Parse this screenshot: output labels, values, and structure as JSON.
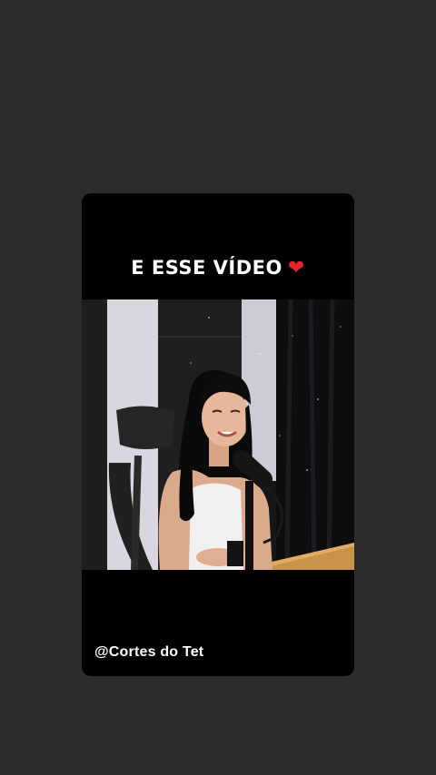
{
  "story": {
    "caption_text": "E ESSE VÍDEO",
    "caption_emoji": "❤",
    "watermark": "@Cortes do Tet"
  },
  "colors": {
    "page_background": "#2d2c2c",
    "card_background": "#000000",
    "heart": "#e0262b",
    "caption_text": "#ffffff"
  }
}
